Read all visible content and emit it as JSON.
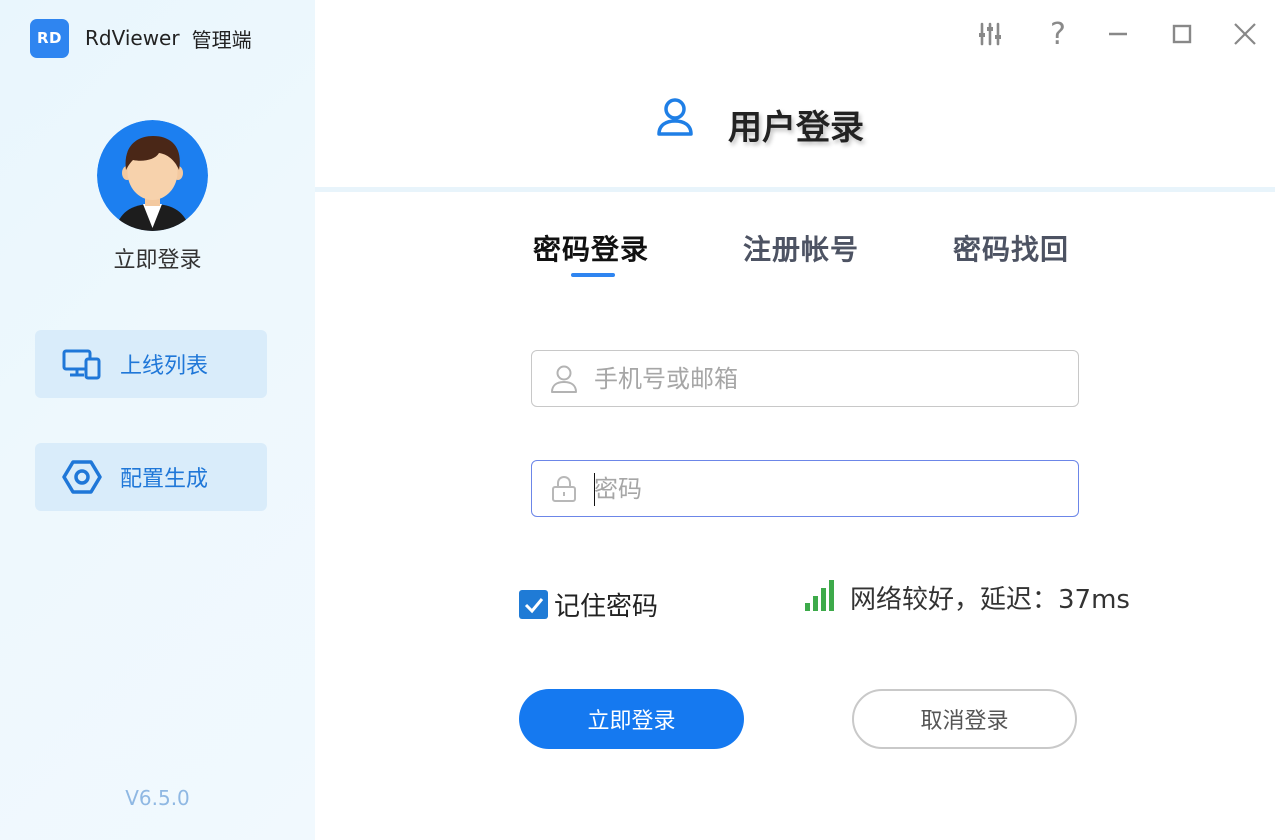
{
  "app": {
    "logo_text": "RD",
    "name": "RdViewer",
    "suffix": "管理端",
    "version": "V6.5.0"
  },
  "sidebar": {
    "avatar_caption": "立即登录",
    "items": [
      {
        "label": "上线列表",
        "icon": "devices-icon"
      },
      {
        "label": "配置生成",
        "icon": "hexagon-settings-icon"
      }
    ]
  },
  "window_controls": [
    "settings-sliders-icon",
    "help-icon",
    "minimize-icon",
    "maximize-icon",
    "close-icon"
  ],
  "header": {
    "title": "用户登录",
    "icon": "user-icon"
  },
  "tabs": [
    {
      "label": "密码登录",
      "active": true
    },
    {
      "label": "注册帐号",
      "active": false
    },
    {
      "label": "密码找回",
      "active": false
    }
  ],
  "form": {
    "account": {
      "placeholder": "手机号或邮箱",
      "value": ""
    },
    "password": {
      "placeholder": "密码",
      "value": ""
    },
    "remember_label": "记住密码",
    "remember_checked": true,
    "network_status": "网络较好，延迟：37ms",
    "login_button": "立即登录",
    "cancel_button": "取消登录"
  },
  "colors": {
    "accent": "#1579f0",
    "sidebar_item_bg": "#d9ecfa",
    "signal_green": "#3daa4a",
    "checkbox": "#1f7bd6"
  }
}
